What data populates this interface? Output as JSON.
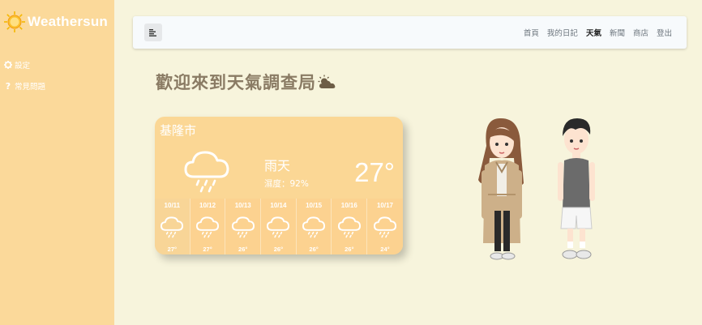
{
  "sidebar": {
    "brand": "Weathersun",
    "items": [
      {
        "label": "設定",
        "icon": "gear-icon"
      },
      {
        "label": "常見問題",
        "icon": "question-icon"
      }
    ]
  },
  "navbar": {
    "menu_icon": "menu-icon",
    "links": [
      {
        "label": "首頁",
        "active": false
      },
      {
        "label": "我的日記",
        "active": false
      },
      {
        "label": "天氣",
        "active": true
      },
      {
        "label": "新聞",
        "active": false
      },
      {
        "label": "商店",
        "active": false
      },
      {
        "label": "登出",
        "active": false
      }
    ]
  },
  "page": {
    "title": "歡迎來到天氣調查局",
    "title_icon": "sun-behind-cloud-icon"
  },
  "weather": {
    "city": "基隆市",
    "condition": "雨天",
    "humidity": "濕度：92%",
    "temperature": "27°",
    "icon": "rain-cloud-icon",
    "forecast": [
      {
        "date": "10/11",
        "temp": "27°",
        "icon": "rain-cloud-icon"
      },
      {
        "date": "10/12",
        "temp": "27°",
        "icon": "rain-cloud-icon"
      },
      {
        "date": "10/13",
        "temp": "26°",
        "icon": "rain-cloud-icon"
      },
      {
        "date": "10/14",
        "temp": "26°",
        "icon": "rain-cloud-icon"
      },
      {
        "date": "10/15",
        "temp": "26°",
        "icon": "rain-cloud-icon"
      },
      {
        "date": "10/16",
        "temp": "26°",
        "icon": "rain-cloud-icon"
      },
      {
        "date": "10/17",
        "temp": "24°",
        "icon": "rain-cloud-icon"
      }
    ]
  },
  "colors": {
    "sidebar": "#fbd99a",
    "background": "#f7f4dc",
    "card": "#fbd795",
    "title": "#8a7b64"
  }
}
